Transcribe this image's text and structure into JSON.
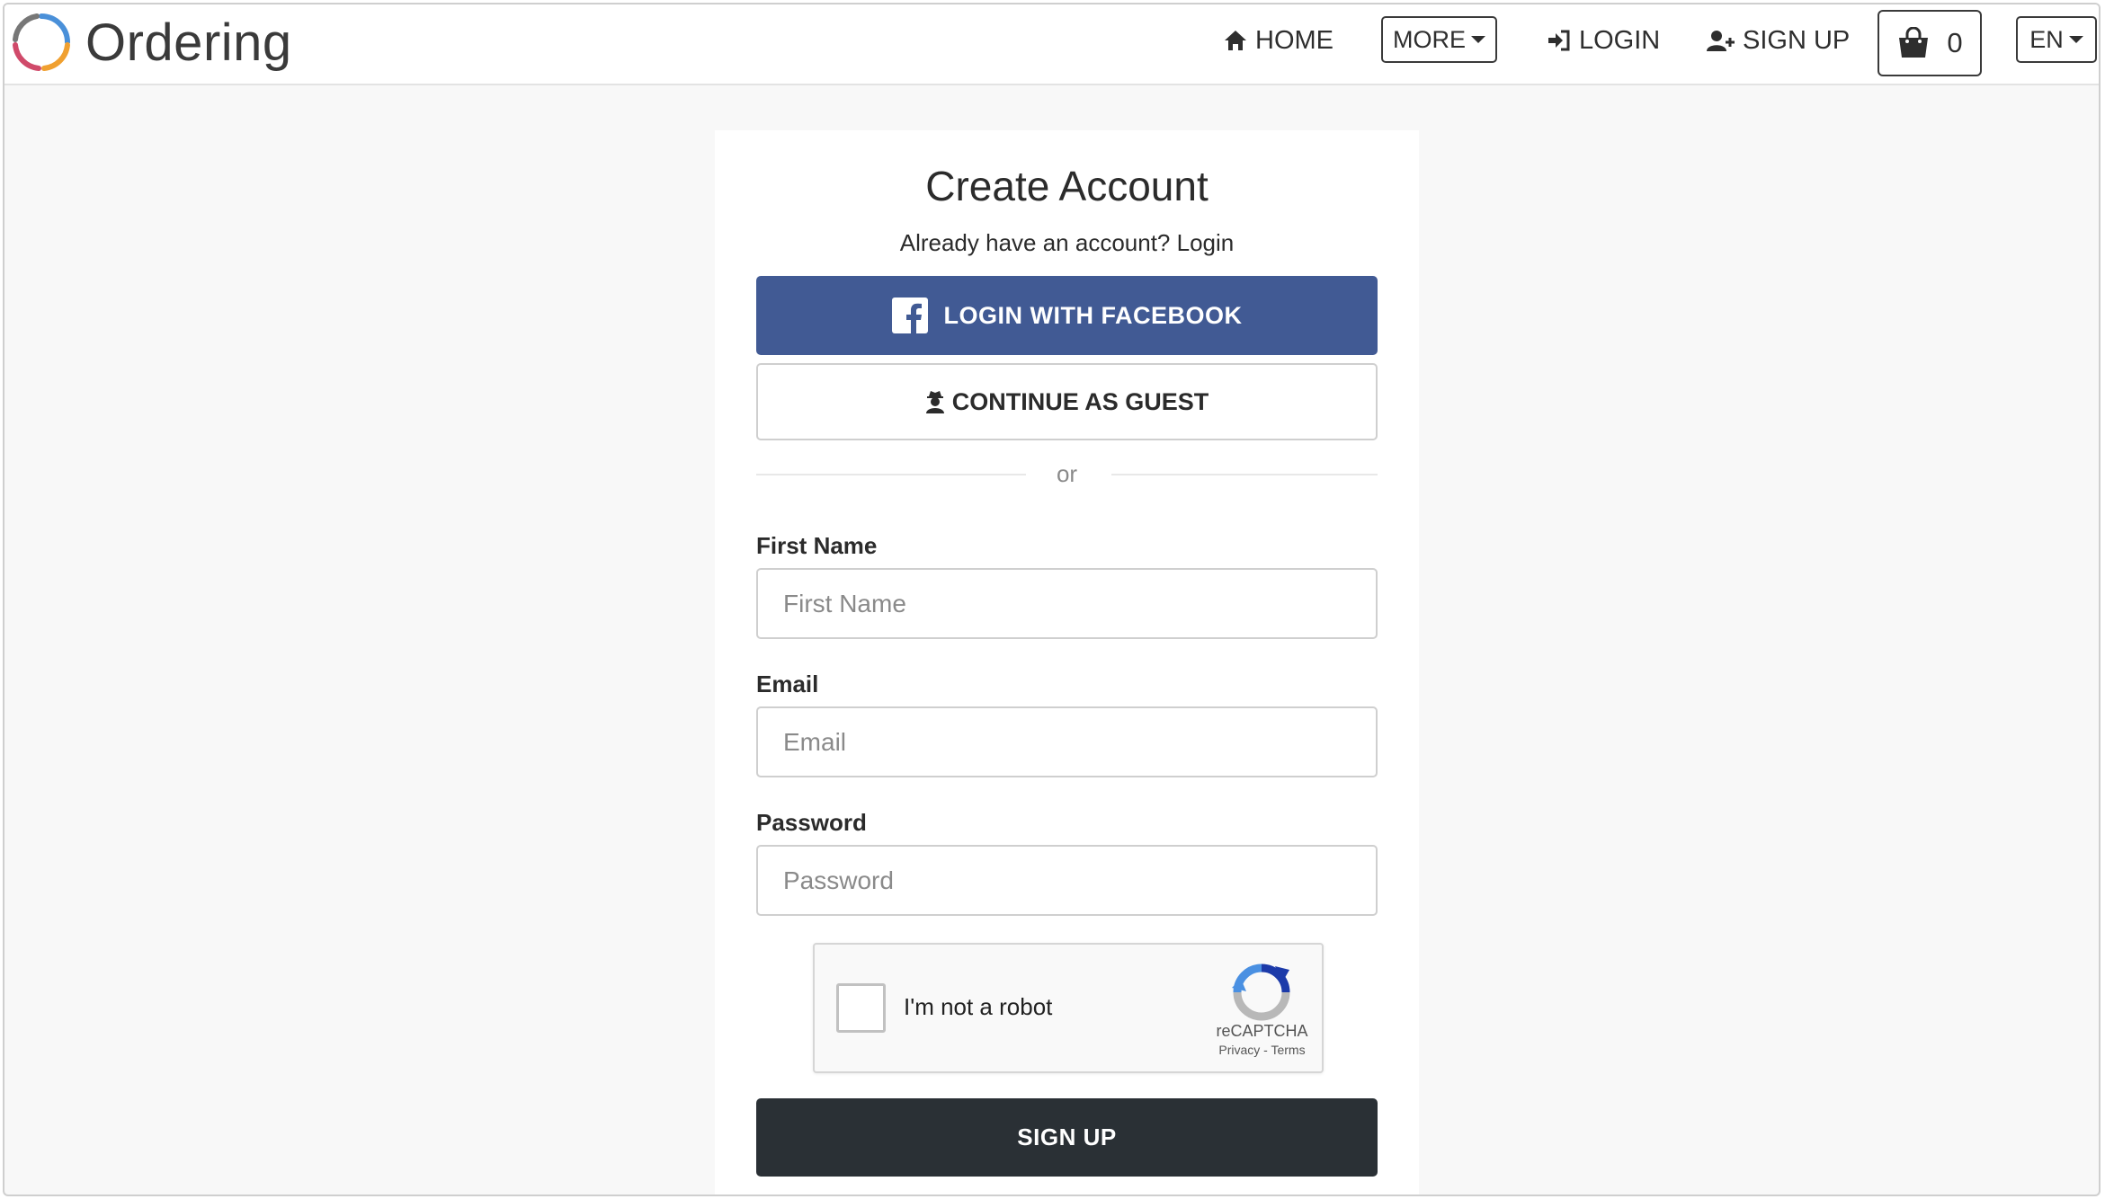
{
  "header": {
    "logo_text": "Ordering",
    "nav": {
      "home": "HOME",
      "more": "MORE",
      "login": "LOGIN",
      "signup": "SIGN UP"
    },
    "cart_count": "0",
    "language": "EN"
  },
  "card": {
    "title": "Create Account",
    "subtitle_prefix": "Already have an account?",
    "subtitle_link": "Login",
    "facebook_button": "LOGIN WITH FACEBOOK",
    "guest_button": "CONTINUE AS GUEST",
    "divider_text": "or",
    "fields": {
      "first_name": {
        "label": "First Name",
        "placeholder": "First Name",
        "value": ""
      },
      "email": {
        "label": "Email",
        "placeholder": "Email",
        "value": ""
      },
      "password": {
        "label": "Password",
        "placeholder": "Password",
        "value": ""
      }
    },
    "captcha": {
      "text": "I'm not a robot",
      "brand": "reCAPTCHA",
      "privacy": "Privacy",
      "separator": "-",
      "terms": "Terms"
    },
    "signup_button": "SIGN UP"
  },
  "colors": {
    "facebook": "#415a94",
    "signup_button": "#2a3035",
    "page_background": "#f8f8f8",
    "logo_blue": "#4a90d9",
    "logo_orange": "#f0a030",
    "logo_pink": "#d04a6a",
    "logo_gray": "#777777"
  },
  "icons": {
    "home": "home-icon",
    "login": "sign-in-icon",
    "signup": "user-plus-icon",
    "cart": "shopping-bag-icon",
    "facebook": "facebook-icon",
    "guest": "user-secret-icon",
    "captcha": "recaptcha-icon"
  }
}
